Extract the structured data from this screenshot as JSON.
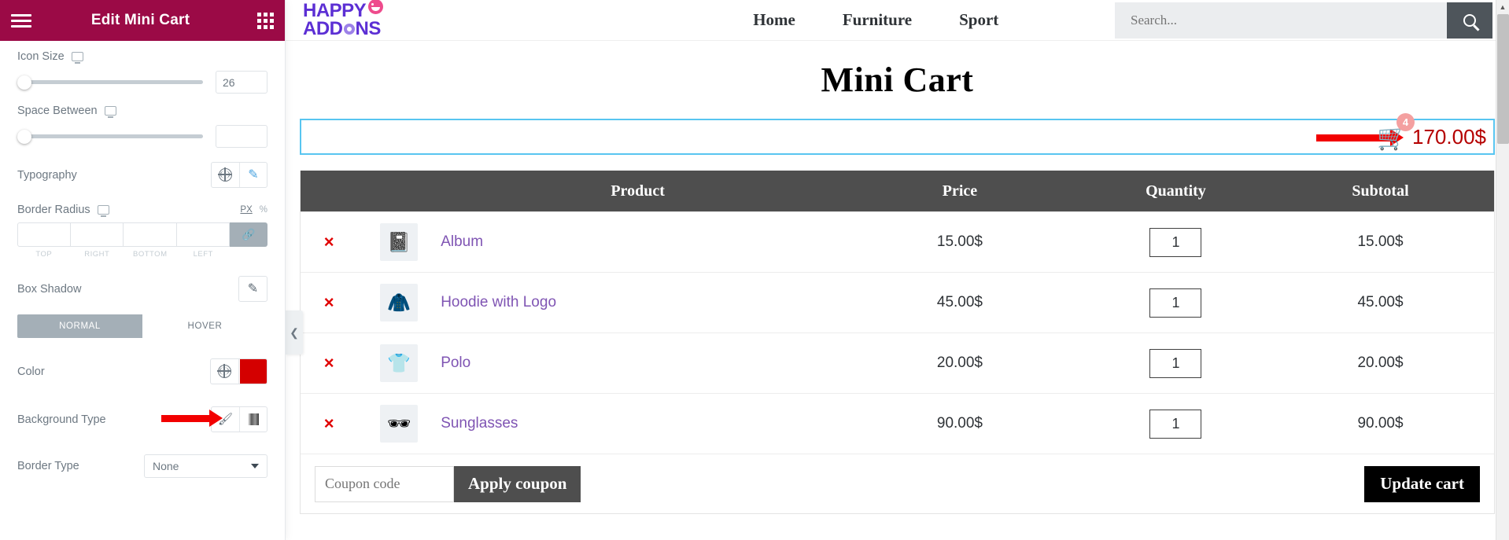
{
  "panel": {
    "title": "Edit Mini Cart",
    "menu_icon": "hamburger-icon",
    "apps_icon": "grid-apps-icon",
    "controls": {
      "icon_size": {
        "label": "Icon Size",
        "value": "26",
        "device_icon": "desktop-icon",
        "slider_percent": 3
      },
      "space_between": {
        "label": "Space Between",
        "value": "",
        "device_icon": "desktop-icon",
        "slider_percent": 0
      },
      "typography": {
        "label": "Typography",
        "globe_icon": "globe-icon",
        "edit_icon": "pencil-icon"
      },
      "border_radius": {
        "label": "Border Radius",
        "device_icon": "desktop-icon",
        "units": [
          "PX",
          "%"
        ],
        "active_unit": "PX",
        "fields": [
          {
            "label": "TOP",
            "value": ""
          },
          {
            "label": "RIGHT",
            "value": ""
          },
          {
            "label": "BOTTOM",
            "value": ""
          },
          {
            "label": "LEFT",
            "value": ""
          }
        ],
        "link_icon": "link-chain-icon"
      },
      "box_shadow": {
        "label": "Box Shadow",
        "edit_icon": "pencil-icon"
      },
      "state_tabs": {
        "normal": "NORMAL",
        "hover": "HOVER",
        "active": "NORMAL"
      },
      "color": {
        "label": "Color",
        "globe_icon": "globe-icon",
        "swatch_hex": "#d40000"
      },
      "background_type": {
        "label": "Background Type",
        "classic_icon": "brush-icon",
        "gradient_icon": "gradient-icon"
      },
      "border_type": {
        "label": "Border Type",
        "value": "None",
        "caret_icon": "chevron-down-icon"
      }
    },
    "collapse_handle_icon": "chevron-left-icon"
  },
  "site": {
    "logo": {
      "line1": "HAPPY",
      "line2_a": "ADD",
      "line2_b": "NS",
      "smiley_icon": "smiley-face-icon"
    },
    "nav": [
      "Home",
      "Furniture",
      "Sport"
    ],
    "search": {
      "placeholder": "Search...",
      "value": "",
      "button_icon": "search-icon"
    }
  },
  "page": {
    "title": "Mini Cart",
    "mini_cart_widget": {
      "cart_icon": "shopping-cart-icon",
      "badge_count": "4",
      "total": "170.00$"
    },
    "table": {
      "headers": [
        "",
        "",
        "Product",
        "Price",
        "Quantity",
        "Subtotal"
      ],
      "rows": [
        {
          "remove": "×",
          "thumb_icon": "album-thumbnail",
          "thumb_glyph": "📓",
          "name": "Album",
          "price": "15.00$",
          "qty": "1",
          "subtotal": "15.00$"
        },
        {
          "remove": "×",
          "thumb_icon": "hoodie-thumbnail",
          "thumb_glyph": "🧥",
          "name": "Hoodie with Logo",
          "price": "45.00$",
          "qty": "1",
          "subtotal": "45.00$"
        },
        {
          "remove": "×",
          "thumb_icon": "polo-thumbnail",
          "thumb_glyph": "👕",
          "name": "Polo",
          "price": "20.00$",
          "qty": "1",
          "subtotal": "20.00$"
        },
        {
          "remove": "×",
          "thumb_icon": "sunglasses-thumbnail",
          "thumb_glyph": "🕶",
          "name": "Sunglasses",
          "price": "90.00$",
          "qty": "1",
          "subtotal": "90.00$"
        }
      ],
      "footer": {
        "coupon_placeholder": "Coupon code",
        "coupon_value": "",
        "apply_coupon": "Apply coupon",
        "update_cart": "Update cart"
      }
    }
  },
  "scrollbar": {
    "up_arrow_icon": "scroll-up-arrow"
  },
  "annotations": {
    "arrow_color": "#f20000"
  }
}
